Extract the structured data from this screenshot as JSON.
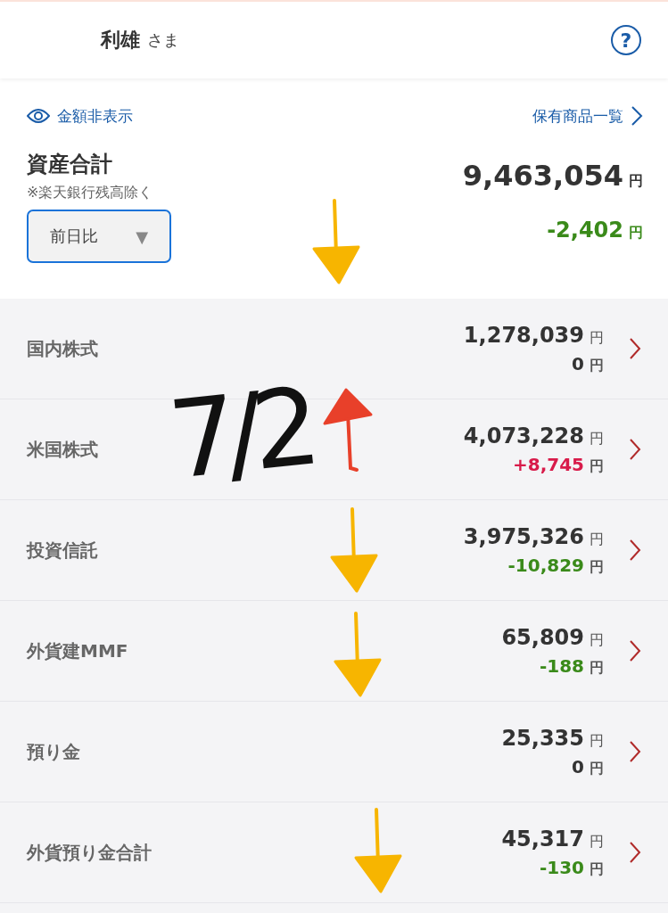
{
  "header": {
    "user_name": "利雄",
    "honorific": "さま",
    "help_icon": "?"
  },
  "summary": {
    "hide_amounts": "金額非表示",
    "holdings_link": "保有商品一覧",
    "title": "資産合計",
    "note": "※楽天銀行残高除く",
    "comparison": {
      "value": "前日比",
      "caret": "▼"
    },
    "total": "9,463,054",
    "total_unit": "円",
    "change": "-2,402",
    "change_unit": "円",
    "color": "#3a8a1a",
    "annotation": {
      "pointing_up": false,
      "color": "#f7b500"
    }
  },
  "assets": [
    {
      "name": "国内株式",
      "amount": "1,278,039",
      "amount_unit": "円",
      "change": "0",
      "change_unit": "円",
      "color": "#333333"
    },
    {
      "name": "米国株式",
      "amount": "4,073,228",
      "amount_unit": "円",
      "change": "+8,745",
      "change_unit": "円",
      "color": "#d81b4a",
      "annotation": {
        "pointing_up": true,
        "color": "#e8402a"
      }
    },
    {
      "name": "投資信託",
      "amount": "3,975,326",
      "amount_unit": "円",
      "change": "-10,829",
      "change_unit": "円",
      "color": "#3a8a1a",
      "annotation": {
        "pointing_up": false,
        "color": "#f7b500"
      }
    },
    {
      "name": "外貨建MMF",
      "amount": "65,809",
      "amount_unit": "円",
      "change": "-188",
      "change_unit": "円",
      "color": "#3a8a1a",
      "annotation": {
        "pointing_up": false,
        "color": "#f7b500"
      }
    },
    {
      "name": "預り金",
      "amount": "25,335",
      "amount_unit": "円",
      "change": "0",
      "change_unit": "円",
      "color": "#333333"
    },
    {
      "name": "外貨預り金合計",
      "amount": "45,317",
      "amount_unit": "円",
      "change": "-130",
      "change_unit": "円",
      "color": "#3a8a1a",
      "annotation": {
        "pointing_up": false,
        "color": "#f7b500"
      }
    }
  ],
  "handwritten_note": "7/2"
}
